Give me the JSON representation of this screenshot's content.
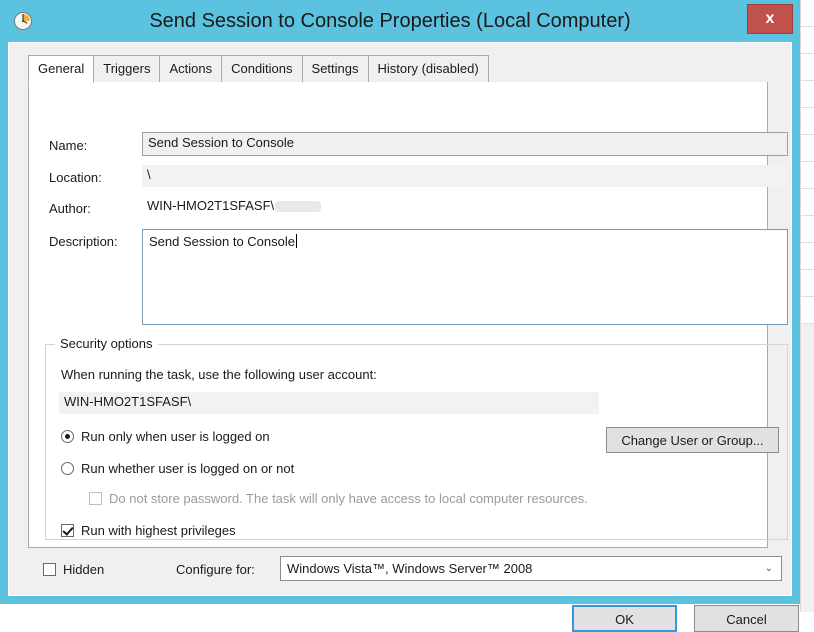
{
  "window": {
    "title": "Send Session to Console Properties (Local Computer)",
    "icon": "clock-task-icon",
    "close_label": "x",
    "frame_color": "#5bc2e0",
    "close_button_color": "#c0524b"
  },
  "tabs": [
    {
      "label": "General",
      "active": true
    },
    {
      "label": "Triggers",
      "active": false
    },
    {
      "label": "Actions",
      "active": false
    },
    {
      "label": "Conditions",
      "active": false
    },
    {
      "label": "Settings",
      "active": false
    },
    {
      "label": "History (disabled)",
      "active": false
    }
  ],
  "general": {
    "name_label": "Name:",
    "name_value": "Send Session to Console",
    "location_label": "Location:",
    "location_value": "\\",
    "author_label": "Author:",
    "author_value": "WIN-HMO2T1SFASF\\",
    "description_label": "Description:",
    "description_value": "Send Session to Console"
  },
  "security": {
    "legend": "Security options",
    "account_prompt": "When running the task, use the following user account:",
    "account_value": "WIN-HMO2T1SFASF\\",
    "change_user_label": "Change User or Group...",
    "options": [
      {
        "type": "radio",
        "label": "Run only when user is logged on",
        "checked": true,
        "disabled": false
      },
      {
        "type": "radio",
        "label": "Run whether user is logged on or not",
        "checked": false,
        "disabled": false
      },
      {
        "type": "checkbox",
        "label": "Do not store password.  The task will only have access to local computer resources.",
        "checked": false,
        "disabled": true
      },
      {
        "type": "checkbox",
        "label": "Run with highest privileges",
        "checked": true,
        "disabled": false
      }
    ]
  },
  "bottom": {
    "hidden_label": "Hidden",
    "hidden_checked": false,
    "configure_label": "Configure for:",
    "configure_value": "Windows Vista™, Windows Server™ 2008",
    "configure_arrow": "⌄"
  },
  "footer": {
    "ok_label": "OK",
    "cancel_label": "Cancel"
  }
}
